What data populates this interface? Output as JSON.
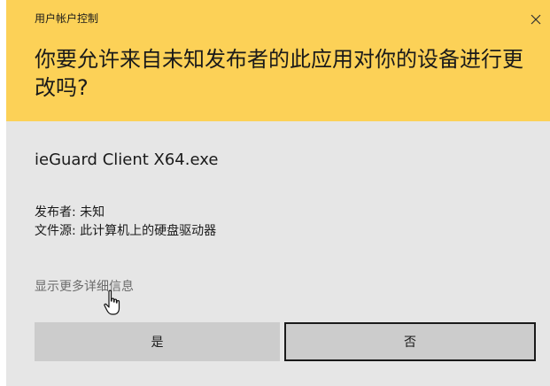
{
  "dialog": {
    "title": "用户帐户控制",
    "question": "你要允许来自未知发布者的此应用对你的设备进行更改吗?",
    "app_name": "ieGuard Client X64.exe",
    "publisher": "发布者: 未知",
    "file_source": "文件源: 此计算机上的硬盘驱动器",
    "show_more": "显示更多详细信息",
    "yes_label": "是",
    "no_label": "否"
  },
  "colors": {
    "header_bg": "#fcd157",
    "body_bg": "#e6e6e6",
    "button_bg": "#cccccc",
    "link": "#6b6b6b"
  },
  "icons": {
    "close": "close-icon",
    "cursor": "hand-pointer-cursor-icon"
  }
}
